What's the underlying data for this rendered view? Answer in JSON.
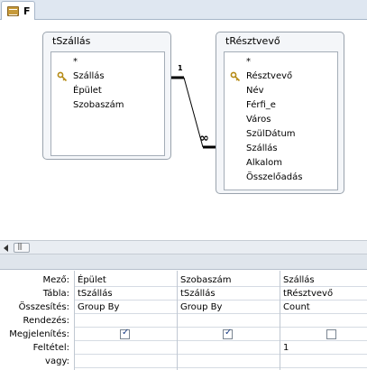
{
  "tab": {
    "label": "F"
  },
  "tables": [
    {
      "title": "tSzállás",
      "fields": [
        {
          "name": "*",
          "key": false
        },
        {
          "name": "Szállás",
          "key": true
        },
        {
          "name": "Épület",
          "key": false
        },
        {
          "name": "Szobaszám",
          "key": false
        }
      ]
    },
    {
      "title": "tRésztvevő",
      "fields": [
        {
          "name": "*",
          "key": false
        },
        {
          "name": "Résztvevő",
          "key": true
        },
        {
          "name": "Név",
          "key": false
        },
        {
          "name": "Férfi_e",
          "key": false
        },
        {
          "name": "Város",
          "key": false
        },
        {
          "name": "SzülDátum",
          "key": false
        },
        {
          "name": "Szállás",
          "key": false
        },
        {
          "name": "Alkalom",
          "key": false
        },
        {
          "name": "Összelőadás",
          "key": false
        }
      ]
    }
  ],
  "relationship": {
    "one_label": "1",
    "many_label": "∞"
  },
  "grid": {
    "row_labels": [
      "Mező:",
      "Tábla:",
      "Összesítés:",
      "Rendezés:",
      "Megjelenítés:",
      "Feltétel:",
      "vagy:"
    ],
    "columns": [
      {
        "field": "Épület",
        "table": "tSzállás",
        "total": "Group By",
        "sort": "",
        "show": true,
        "criteria": "",
        "or": ""
      },
      {
        "field": "Szobaszám",
        "table": "tSzállás",
        "total": "Group By",
        "sort": "",
        "show": true,
        "criteria": "",
        "or": ""
      },
      {
        "field": "Szállás",
        "table": "tRésztvevő",
        "total": "Count",
        "sort": "",
        "show": false,
        "criteria": "1",
        "or": ""
      }
    ]
  }
}
